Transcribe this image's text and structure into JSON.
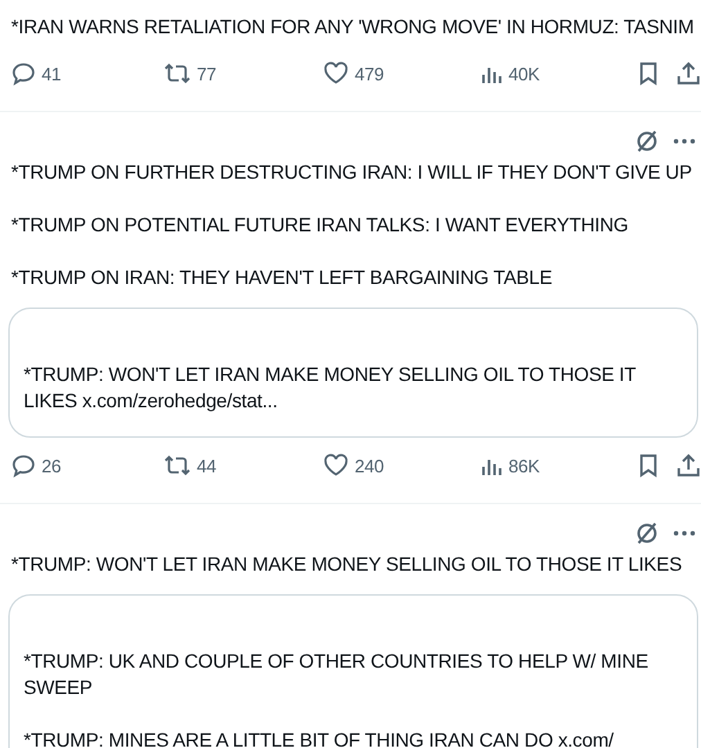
{
  "tweets": [
    {
      "show_header": false,
      "paragraphs": [
        "*IRAN WARNS RETALIATION FOR ANY 'WRONG MOVE' IN HORMUZ: TASNIM"
      ],
      "stats": {
        "replies": "41",
        "reposts": "77",
        "likes": "479",
        "views": "40K"
      }
    },
    {
      "show_header": true,
      "paragraphs": [
        "*TRUMP ON FURTHER DESTRUCTING IRAN: I WILL IF THEY DON'T GIVE UP",
        "*TRUMP ON POTENTIAL FUTURE IRAN TALKS: I WANT EVERYTHING",
        "*TRUMP ON IRAN: THEY HAVEN'T LEFT BARGAINING TABLE"
      ],
      "quote": {
        "paragraphs": [
          "*TRUMP: WON'T LET IRAN MAKE MONEY SELLING OIL TO THOSE IT LIKES x.com/zerohedge/stat..."
        ]
      },
      "stats": {
        "replies": "26",
        "reposts": "44",
        "likes": "240",
        "views": "86K"
      }
    },
    {
      "show_header": true,
      "paragraphs": [
        "*TRUMP: WON'T LET IRAN MAKE MONEY SELLING OIL TO THOSE IT LIKES"
      ],
      "quote": {
        "paragraphs": [
          "*TRUMP: UK AND COUPLE OF OTHER COUNTRIES TO HELP W/ MINE SWEEP",
          "*TRUMP: MINES ARE A LITTLE BIT OF THING IRAN CAN DO x.com/"
        ]
      }
    }
  ]
}
